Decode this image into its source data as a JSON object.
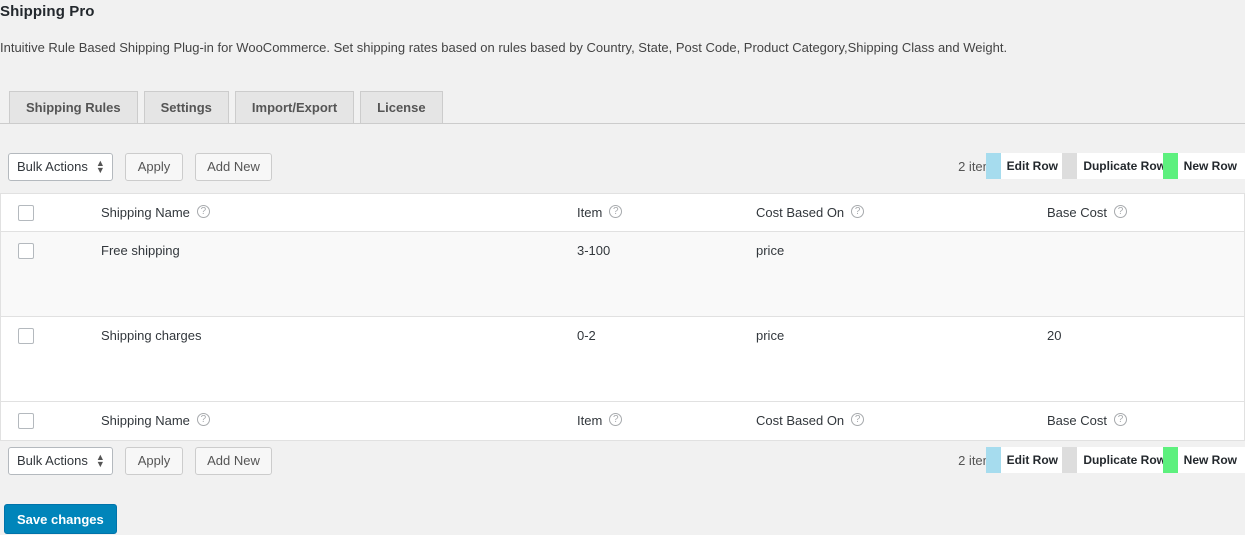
{
  "header": {
    "title": "Shipping Pro",
    "description": "Intuitive Rule Based Shipping Plug-in for WooCommerce. Set shipping rates based on rules based by Country, State, Post Code, Product Category,Shipping Class and Weight."
  },
  "tabs": [
    {
      "label": "Shipping Rules",
      "active": true
    },
    {
      "label": "Settings",
      "active": false
    },
    {
      "label": "Import/Export",
      "active": false
    },
    {
      "label": "License",
      "active": false
    }
  ],
  "toolbar": {
    "bulk_actions_label": "Bulk Actions",
    "apply_label": "Apply",
    "add_new_label": "Add New",
    "items_count": "2 items",
    "edit_row_label": "Edit Row",
    "duplicate_row_label": "Duplicate Row",
    "new_row_label": "New Row",
    "swatch_colors": {
      "edit_row": "#a6dcee",
      "duplicate_row": "#dddddd",
      "new_row": "#5df07e"
    }
  },
  "table": {
    "columns": [
      {
        "label": "Shipping Name",
        "help": "?"
      },
      {
        "label": "Item",
        "help": "?"
      },
      {
        "label": "Cost Based On",
        "help": "?"
      },
      {
        "label": "Base Cost",
        "help": "?"
      }
    ],
    "rows": [
      {
        "shipping_name": "Free shipping",
        "item": "3-100",
        "cost_based_on": "price",
        "base_cost": ""
      },
      {
        "shipping_name": "Shipping charges",
        "item": "0-2",
        "cost_based_on": "price",
        "base_cost": "20"
      }
    ]
  },
  "footer": {
    "save_label": "Save changes",
    "save_color": "#0085ba"
  }
}
